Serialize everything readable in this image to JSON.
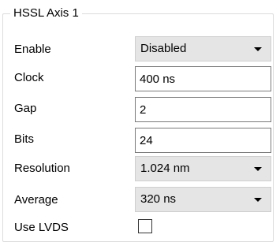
{
  "group": {
    "title": "HSSL Axis 1"
  },
  "rows": {
    "enable": {
      "label": "Enable",
      "value": "Disabled",
      "control": "dropdown"
    },
    "clock": {
      "label": "Clock",
      "value": "400 ns",
      "control": "textbox"
    },
    "gap": {
      "label": "Gap",
      "value": "2",
      "control": "textbox"
    },
    "bits": {
      "label": "Bits",
      "value": "24",
      "control": "textbox"
    },
    "resolution": {
      "label": "Resolution",
      "value": "1.024 nm",
      "control": "dropdown"
    },
    "average": {
      "label": "Average",
      "value": "320 ns",
      "control": "dropdown"
    },
    "use_lvds": {
      "label": "Use LVDS",
      "checked": false,
      "control": "checkbox"
    }
  },
  "icons": {
    "dropdown_arrow": "chevron-down-icon"
  },
  "colors": {
    "background": "#ffffff",
    "combo_background": "#e5e5e5",
    "textbox_border": "#7a7a7a",
    "group_border": "#dcdcdc"
  }
}
